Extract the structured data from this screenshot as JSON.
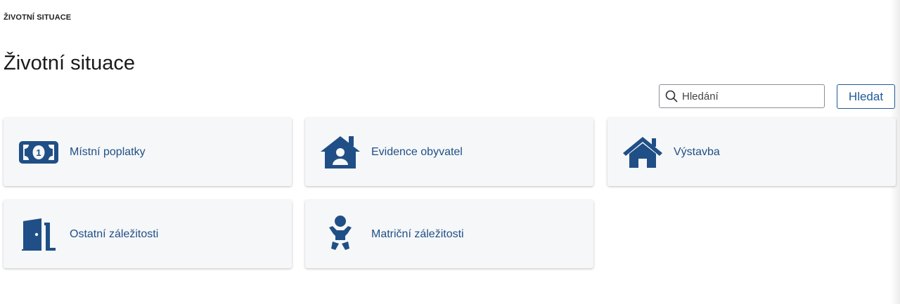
{
  "breadcrumb": "ŽIVOTNÍ SITUACE",
  "title": "Životní situace",
  "search": {
    "placeholder": "Hledání",
    "button_label": "Hledat"
  },
  "cards": [
    {
      "label": "Místní poplatky",
      "icon": "money-bill-icon"
    },
    {
      "label": "Evidence obyvatel",
      "icon": "house-user-icon"
    },
    {
      "label": "Výstavba",
      "icon": "home-icon"
    },
    {
      "label": "Ostatní záležitosti",
      "icon": "door-open-icon"
    },
    {
      "label": "Matriční záležitosti",
      "icon": "baby-icon"
    }
  ],
  "colors": {
    "accent": "#1f4f86",
    "card_bg": "#f6f7f9",
    "text": "#1a1a1a"
  }
}
